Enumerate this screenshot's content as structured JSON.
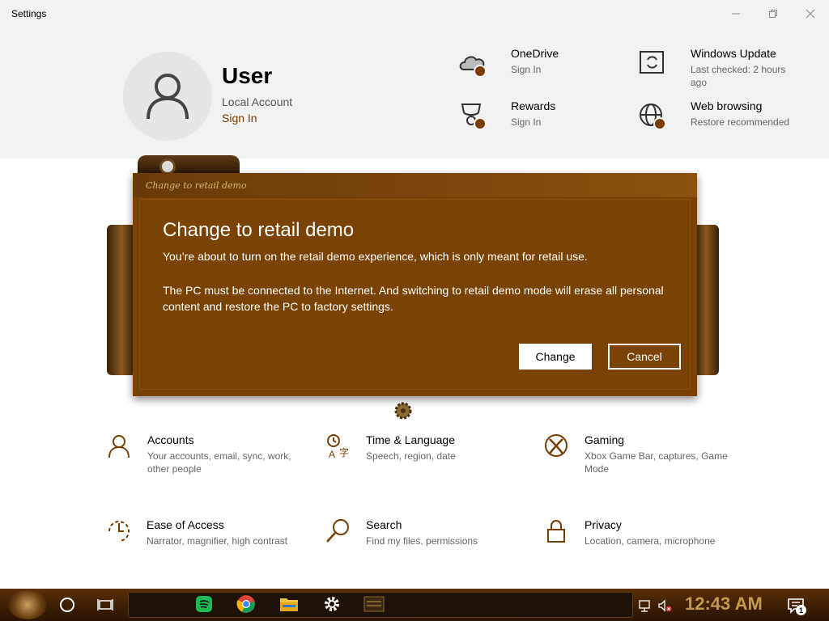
{
  "window": {
    "title": "Settings"
  },
  "header": {
    "user_name": "User",
    "account_type": "Local Account",
    "sign_in": "Sign In",
    "items": [
      {
        "title": "OneDrive",
        "sub": "Sign In",
        "icon": "cloud-icon"
      },
      {
        "title": "Windows Update",
        "sub": "Last checked: 2 hours ago",
        "icon": "update-icon"
      },
      {
        "title": "Rewards",
        "sub": "Sign In",
        "icon": "trophy-icon"
      },
      {
        "title": "Web browsing",
        "sub": "Restore recommended",
        "icon": "globe-icon"
      }
    ]
  },
  "dialog": {
    "caption": "Change to retail demo",
    "title": "Change to retail demo",
    "text1": "You’re about to turn on the retail demo experience, which is only meant for retail use.",
    "text2": "The PC must be connected to the Internet. And switching to retail demo mode will erase all personal content and restore the PC to factory settings.",
    "change_label": "Change",
    "cancel_label": "Cancel"
  },
  "categories": [
    {
      "title": "Accounts",
      "sub": "Your accounts, email, sync, work, other people",
      "icon": "person-icon"
    },
    {
      "title": "Time & Language",
      "sub": "Speech, region, date",
      "icon": "language-icon"
    },
    {
      "title": "Gaming",
      "sub": "Xbox Game Bar, captures, Game Mode",
      "icon": "xbox-icon"
    },
    {
      "title": "Ease of Access",
      "sub": "Narrator, magnifier, high contrast",
      "icon": "ease-of-access-icon"
    },
    {
      "title": "Search",
      "sub": "Find my files, permissions",
      "icon": "search-icon"
    },
    {
      "title": "Privacy",
      "sub": "Location, camera, microphone",
      "icon": "lock-icon"
    }
  ],
  "taskbar": {
    "clock": "12:43 AM",
    "notification_count": "1"
  },
  "colors": {
    "accent": "#7a3d00",
    "dialog_bg": "#7a4204",
    "header_bg": "#f2f2f2"
  }
}
